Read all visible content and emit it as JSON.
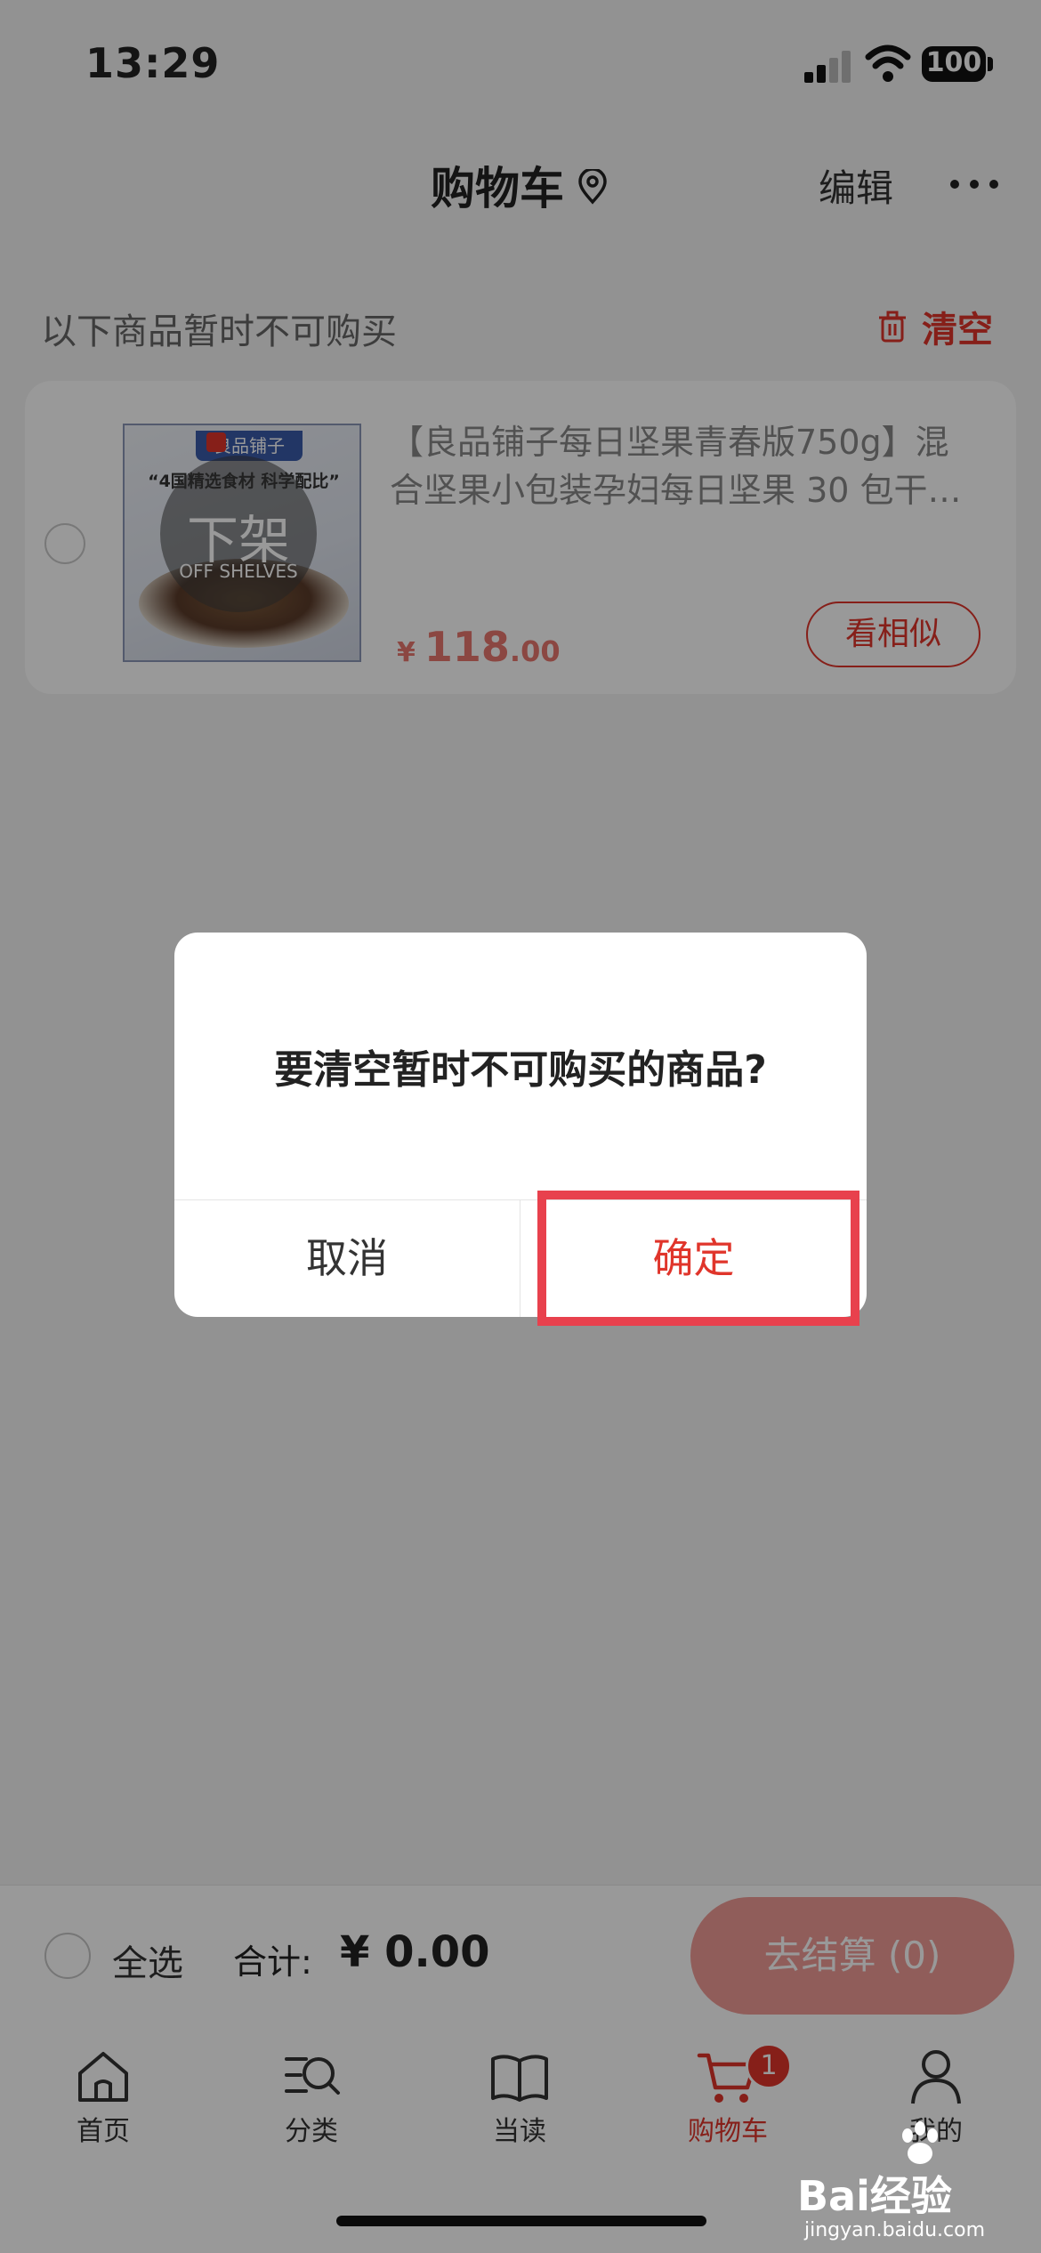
{
  "status_bar": {
    "time": "13:29",
    "battery": "100"
  },
  "nav": {
    "title": "购物车",
    "edit": "编辑"
  },
  "unavailable": {
    "header": "以下商品暂时不可购买",
    "clear_label": "清空",
    "product": {
      "title": "【良品铺子每日坚果青春版750g】混合坚果小包装孕妇每日坚果 30 包干…",
      "price_currency": "¥",
      "price_integer": "118",
      "price_decimal": ".00",
      "similar_button": "看相似",
      "thumb_brand": "良品铺子",
      "thumb_slogan": "“4国精选食材 科学配比”",
      "status_cn": "下架",
      "status_en": "OFF SHELVES"
    }
  },
  "checkout": {
    "select_all": "全选",
    "total_label": "合计:",
    "total_amount": "¥ 0.00",
    "pay_button": "去结算 (0)"
  },
  "tabbar": {
    "items": [
      {
        "label": "首页",
        "icon": "home-icon"
      },
      {
        "label": "分类",
        "icon": "category-search-icon"
      },
      {
        "label": "当读",
        "icon": "book-icon"
      },
      {
        "label": "购物车",
        "icon": "cart-icon",
        "active": true,
        "badge": "1"
      },
      {
        "label": "我的",
        "icon": "profile-icon"
      }
    ]
  },
  "dialog": {
    "message": "要清空暂时不可购买的商品?",
    "cancel": "取消",
    "confirm": "确定"
  },
  "watermark": {
    "text": "Bai经验",
    "url": "jingyan.baidu.com"
  },
  "colors": {
    "accent": "#e0352b",
    "highlight_box": "#e8414d"
  }
}
